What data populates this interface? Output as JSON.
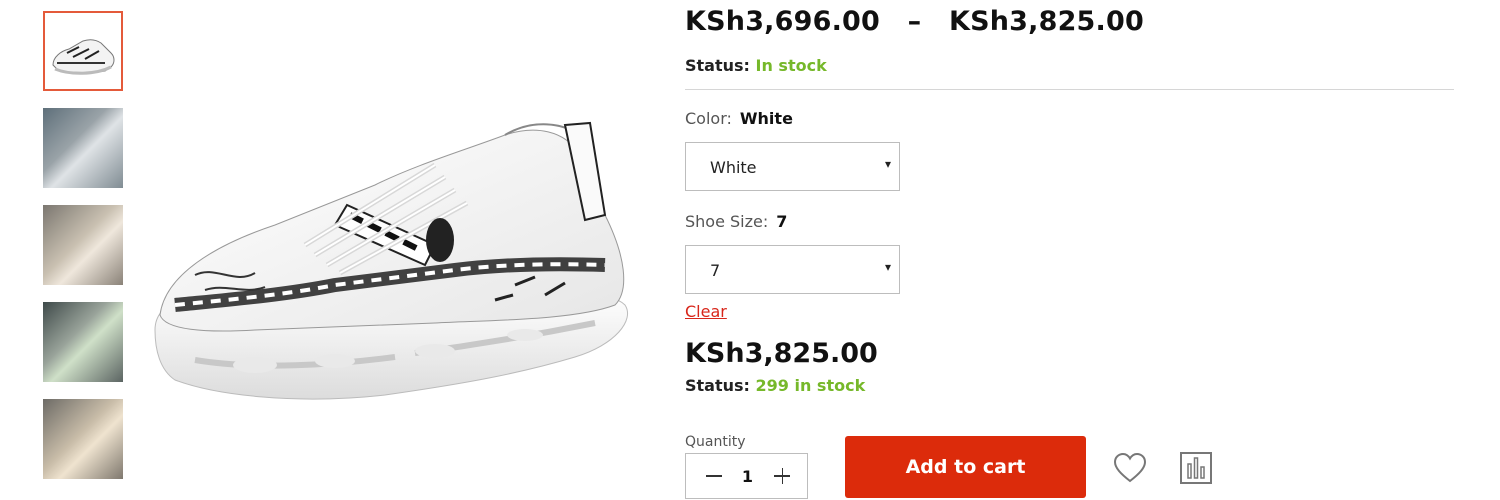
{
  "product": {
    "price_min": "KSh3,696.00",
    "price_sep": "–",
    "price_max": "KSh3,825.00",
    "status_label": "Status:",
    "status_value": "In stock"
  },
  "attributes": {
    "color_label": "Color:",
    "color_value": "White",
    "color_select_value": "White",
    "size_label": "Shoe Size:",
    "size_value": "7",
    "size_select_value": "7",
    "clear_label": "Clear"
  },
  "variation": {
    "price": "KSh3,825.00",
    "status_label": "Status:",
    "status_value": "299 in stock"
  },
  "purchase": {
    "quantity_label": "Quantity",
    "quantity_value": "1",
    "add_to_cart_label": "Add to cart"
  },
  "icons": {
    "select_arrow": "▾",
    "wishlist": "heart-icon",
    "compare": "compare-chart-icon"
  },
  "colors": {
    "accent": "#dc2b0b",
    "in_stock": "#76b82a",
    "active_thumb_border": "#e45a3a",
    "clear_link": "#d8261a"
  }
}
